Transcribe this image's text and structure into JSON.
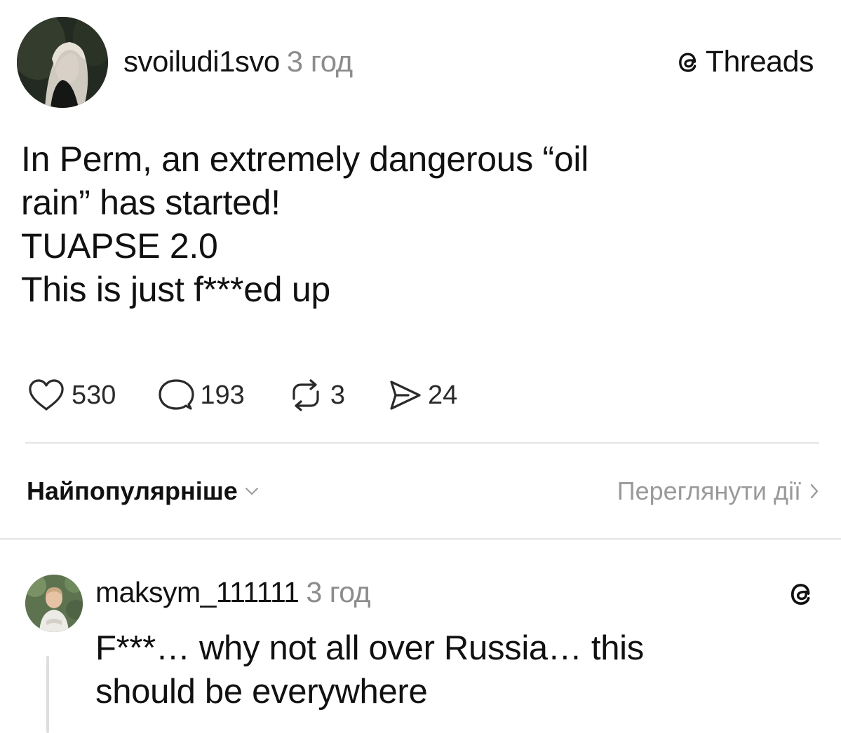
{
  "post": {
    "username": "svoiludi1svo",
    "time": "3 год",
    "platform_label": "Threads",
    "text_lines": [
      "In Perm, an extremely dangerous “oil",
      "rain” has started!",
      "TUAPSE 2.0",
      "This is just f***ed up"
    ],
    "stats": {
      "likes": "530",
      "comments": "193",
      "reposts": "3",
      "shares": "24"
    }
  },
  "replies_bar": {
    "sort_label": "Найпопулярніше",
    "activity_link": "Переглянути дії"
  },
  "reply": {
    "username": "maksym_111111",
    "time": "3 год",
    "text_lines": [
      "F***… why not all over Russia… this",
      "should be everywhere"
    ]
  },
  "icons": {
    "like": "heart-icon",
    "comment": "comment-bubble-icon",
    "repost": "repost-arrows-icon",
    "share": "send-icon",
    "platform": "threads-logo-icon",
    "sort": "chevron-down-icon",
    "activity": "chevron-right-icon"
  }
}
